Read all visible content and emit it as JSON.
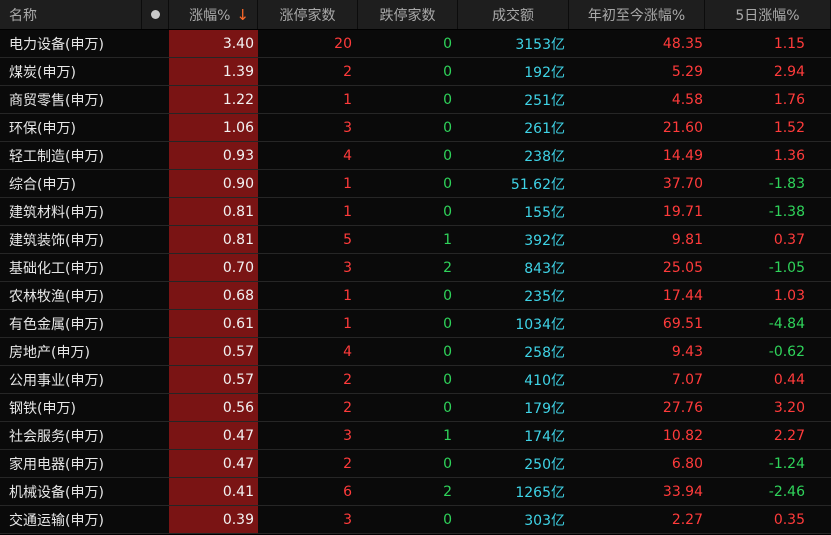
{
  "columns": {
    "name": "名称",
    "change_pct": "涨幅%",
    "sort_arrow": "↓",
    "limit_up": "涨停家数",
    "limit_down": "跌停家数",
    "volume": "成交额",
    "ytd": "年初至今涨幅%",
    "five_day": "5日涨幅%"
  },
  "colors": {
    "up": "#ff3b3b",
    "down": "#2fd35a",
    "volume": "#3fd3e6",
    "change_bg": "#7a1414"
  },
  "rows": [
    {
      "name": "电力设备(申万)",
      "change": "3.40",
      "up": "20",
      "down": "0",
      "volume": "3153亿",
      "ytd": "48.35",
      "d5": "1.15"
    },
    {
      "name": "煤炭(申万)",
      "change": "1.39",
      "up": "2",
      "down": "0",
      "volume": "192亿",
      "ytd": "5.29",
      "d5": "2.94"
    },
    {
      "name": "商贸零售(申万)",
      "change": "1.22",
      "up": "1",
      "down": "0",
      "volume": "251亿",
      "ytd": "4.58",
      "d5": "1.76"
    },
    {
      "name": "环保(申万)",
      "change": "1.06",
      "up": "3",
      "down": "0",
      "volume": "261亿",
      "ytd": "21.60",
      "d5": "1.52"
    },
    {
      "name": "轻工制造(申万)",
      "change": "0.93",
      "up": "4",
      "down": "0",
      "volume": "238亿",
      "ytd": "14.49",
      "d5": "1.36"
    },
    {
      "name": "综合(申万)",
      "change": "0.90",
      "up": "1",
      "down": "0",
      "volume": "51.62亿",
      "ytd": "37.70",
      "d5": "-1.83"
    },
    {
      "name": "建筑材料(申万)",
      "change": "0.81",
      "up": "1",
      "down": "0",
      "volume": "155亿",
      "ytd": "19.71",
      "d5": "-1.38"
    },
    {
      "name": "建筑装饰(申万)",
      "change": "0.81",
      "up": "5",
      "down": "1",
      "volume": "392亿",
      "ytd": "9.81",
      "d5": "0.37"
    },
    {
      "name": "基础化工(申万)",
      "change": "0.70",
      "up": "3",
      "down": "2",
      "volume": "843亿",
      "ytd": "25.05",
      "d5": "-1.05"
    },
    {
      "name": "农林牧渔(申万)",
      "change": "0.68",
      "up": "1",
      "down": "0",
      "volume": "235亿",
      "ytd": "17.44",
      "d5": "1.03"
    },
    {
      "name": "有色金属(申万)",
      "change": "0.61",
      "up": "1",
      "down": "0",
      "volume": "1034亿",
      "ytd": "69.51",
      "d5": "-4.84"
    },
    {
      "name": "房地产(申万)",
      "change": "0.57",
      "up": "4",
      "down": "0",
      "volume": "258亿",
      "ytd": "9.43",
      "d5": "-0.62"
    },
    {
      "name": "公用事业(申万)",
      "change": "0.57",
      "up": "2",
      "down": "0",
      "volume": "410亿",
      "ytd": "7.07",
      "d5": "0.44"
    },
    {
      "name": "钢铁(申万)",
      "change": "0.56",
      "up": "2",
      "down": "0",
      "volume": "179亿",
      "ytd": "27.76",
      "d5": "3.20"
    },
    {
      "name": "社会服务(申万)",
      "change": "0.47",
      "up": "3",
      "down": "1",
      "volume": "174亿",
      "ytd": "10.82",
      "d5": "2.27"
    },
    {
      "name": "家用电器(申万)",
      "change": "0.47",
      "up": "2",
      "down": "0",
      "volume": "250亿",
      "ytd": "6.80",
      "d5": "-1.24"
    },
    {
      "name": "机械设备(申万)",
      "change": "0.41",
      "up": "6",
      "down": "2",
      "volume": "1265亿",
      "ytd": "33.94",
      "d5": "-2.46"
    },
    {
      "name": "交通运输(申万)",
      "change": "0.39",
      "up": "3",
      "down": "0",
      "volume": "303亿",
      "ytd": "2.27",
      "d5": "0.35"
    }
  ]
}
